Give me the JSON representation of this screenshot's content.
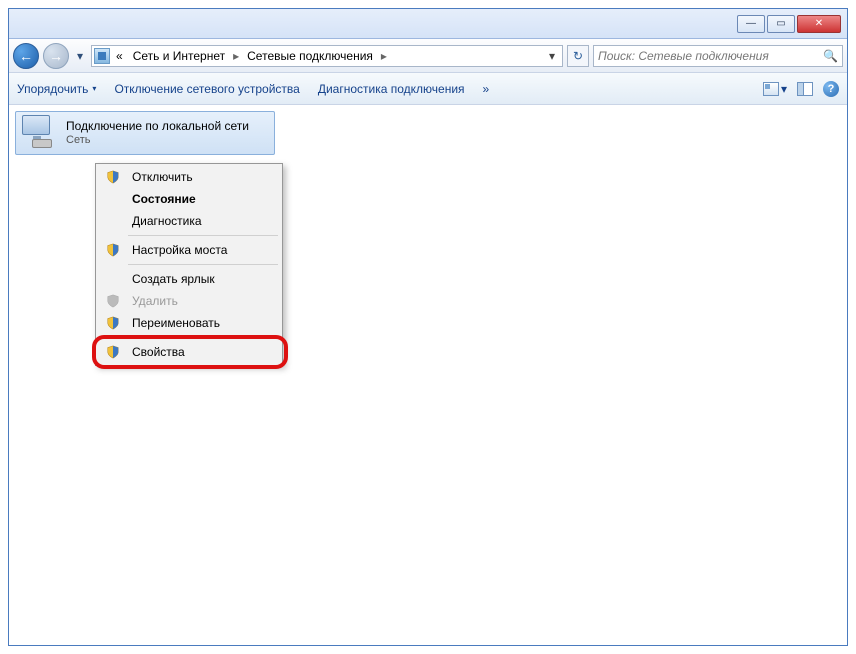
{
  "titlebar": {
    "minimize": "—",
    "maximize": "▭",
    "close": "✕"
  },
  "nav": {
    "back": "←",
    "forward": "→",
    "dropdown": "▾"
  },
  "breadcrumb": {
    "prefix": "«",
    "part1": "Сеть и Интернет",
    "part2": "Сетевые подключения",
    "sep": "▸",
    "dd": "▾"
  },
  "refresh": "↻",
  "search": {
    "placeholder": "Поиск: Сетевые подключения",
    "icon": "🔍"
  },
  "toolbar": {
    "organize": "Упорядочить",
    "disable": "Отключение сетевого устройства",
    "diagnose": "Диагностика подключения",
    "overflow": "»",
    "viewdd": "▾",
    "help": "?"
  },
  "item": {
    "title": "Подключение по локальной сети",
    "sub": "Сеть"
  },
  "ctx": {
    "disable": "Отключить",
    "status": "Состояние",
    "diag": "Диагностика",
    "bridge": "Настройка моста",
    "shortcut": "Создать ярлык",
    "delete": "Удалить",
    "rename": "Переименовать",
    "properties": "Свойства"
  }
}
